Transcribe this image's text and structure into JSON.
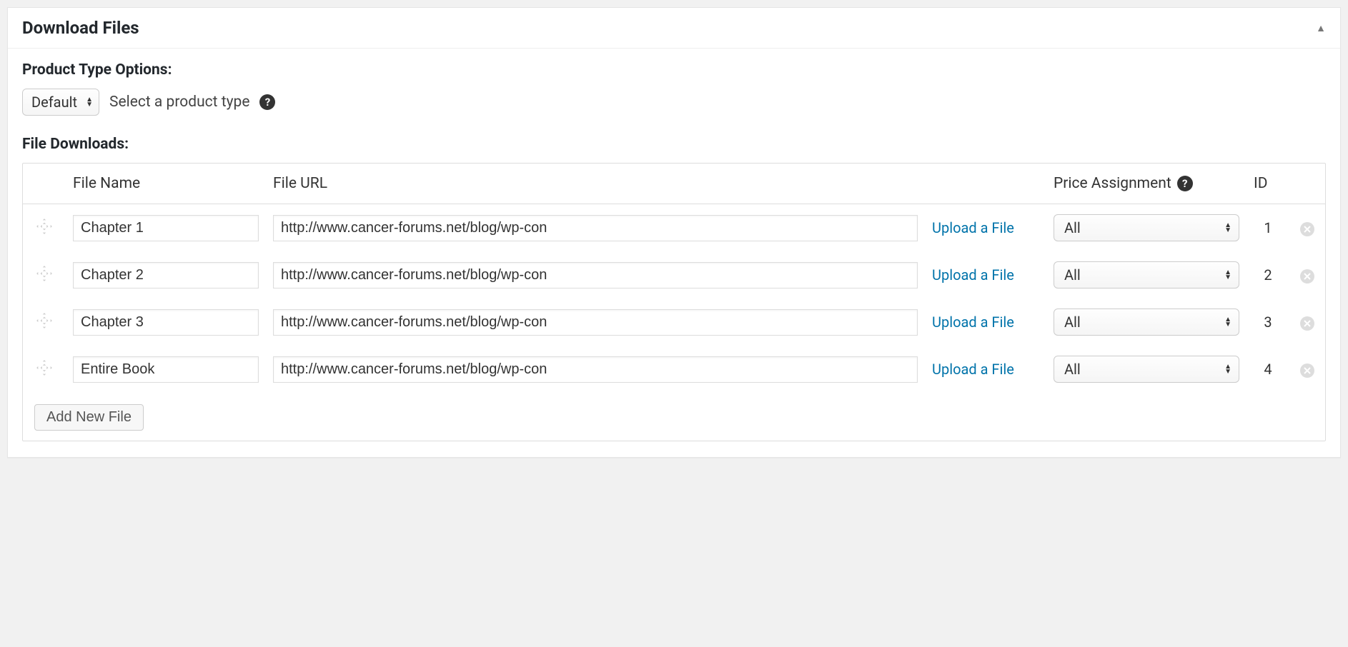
{
  "panel": {
    "title": "Download Files"
  },
  "productType": {
    "label": "Product Type Options:",
    "selected": "Default",
    "hint": "Select a product type"
  },
  "fileDownloads": {
    "label": "File Downloads:",
    "headers": {
      "fileName": "File Name",
      "fileUrl": "File URL",
      "priceAssignment": "Price Assignment",
      "id": "ID"
    },
    "uploadLabel": "Upload a File",
    "priceOptionSelected": "All",
    "rows": [
      {
        "name": "Chapter 1",
        "url": "http://www.cancer-forums.net/blog/wp-con",
        "id": "1"
      },
      {
        "name": "Chapter 2",
        "url": "http://www.cancer-forums.net/blog/wp-con",
        "id": "2"
      },
      {
        "name": "Chapter 3",
        "url": "http://www.cancer-forums.net/blog/wp-con",
        "id": "3"
      },
      {
        "name": "Entire Book",
        "url": "http://www.cancer-forums.net/blog/wp-con",
        "id": "4"
      }
    ],
    "addButton": "Add New File"
  }
}
